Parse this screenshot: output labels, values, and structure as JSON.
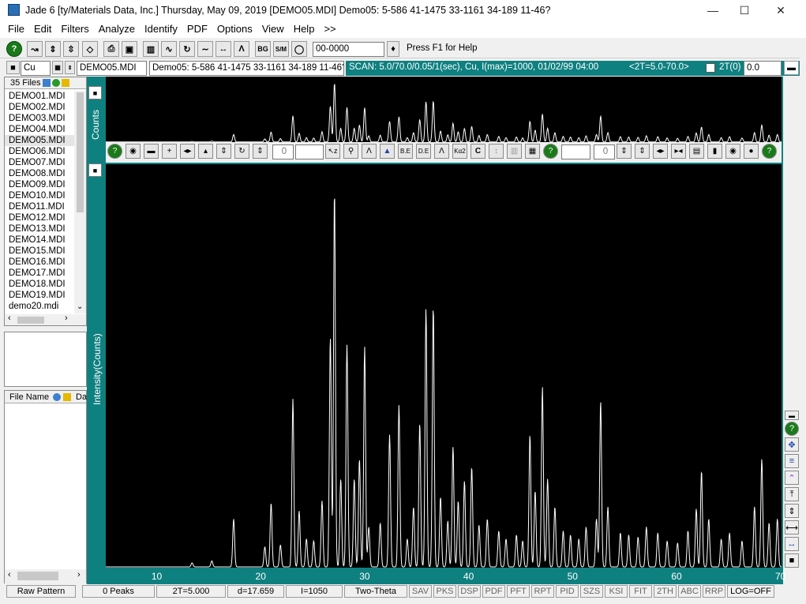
{
  "window": {
    "title": "Jade 6 [ty/Materials Data, Inc.] Thursday, May 09, 2019 [DEMO05.MDI] Demo05: 5-586 41-1475 33-1161 34-189 11-46?"
  },
  "menu": [
    "File",
    "Edit",
    "Filters",
    "Analyze",
    "Identify",
    "PDF",
    "Options",
    "View",
    "Help",
    ">>"
  ],
  "toolbar": {
    "pdf_select": "00-0000",
    "help_text": "Press F1 for Help",
    "bg_label": "BG",
    "sm_label": "S/M"
  },
  "row2": {
    "anode": "Cu",
    "file_select": "DEMO05.MDI",
    "pattern_desc": "Demo05: 5-586 41-1475 33-1161 34-189 11-46?",
    "scan_info": "SCAN: 5.0/70.0/0.05/1(sec), Cu, I(max)=1000, 01/02/99 04:00",
    "range": "<2T=5.0-70.0>",
    "two_theta_label": "2T(0)",
    "two_theta_value": "0.0"
  },
  "files": {
    "header": "35 Files",
    "items": [
      "DEMO01.MDI",
      "DEMO02.MDI",
      "DEMO03.MDI",
      "DEMO04.MDI",
      "DEMO05.MDI",
      "DEMO06.MDI",
      "DEMO07.MDI",
      "DEMO08.MDI",
      "DEMO09.MDI",
      "DEMO10.MDI",
      "DEMO11.MDI",
      "DEMO12.MDI",
      "DEMO13.MDI",
      "DEMO14.MDI",
      "DEMO15.MDI",
      "DEMO16.MDI",
      "DEMO17.MDI",
      "DEMO18.MDI",
      "DEMO19.MDI",
      "demo20.mdi"
    ],
    "selected": "DEMO05.MDI",
    "col_filename": "File Name",
    "col_da": "Da"
  },
  "plot": {
    "top_axis_label": "Counts",
    "main_axis_label": "Intensity(Counts)",
    "zoom_value": "0",
    "toolbar_value": "0"
  },
  "chart_data": {
    "type": "line",
    "xlabel": "",
    "ylabel": "Intensity(Counts)",
    "xlim": [
      5,
      70
    ],
    "ylim": [
      0,
      1000
    ],
    "xticks": [
      10,
      20,
      30,
      40,
      50,
      60,
      70
    ],
    "peaks": [
      {
        "x": 13.3,
        "y": 10
      },
      {
        "x": 15.2,
        "y": 15
      },
      {
        "x": 17.3,
        "y": 120
      },
      {
        "x": 20.3,
        "y": 50
      },
      {
        "x": 20.9,
        "y": 160
      },
      {
        "x": 21.8,
        "y": 55
      },
      {
        "x": 23.0,
        "y": 420
      },
      {
        "x": 23.6,
        "y": 140
      },
      {
        "x": 24.3,
        "y": 70
      },
      {
        "x": 25.0,
        "y": 65
      },
      {
        "x": 25.8,
        "y": 165
      },
      {
        "x": 26.6,
        "y": 575
      },
      {
        "x": 27.0,
        "y": 940
      },
      {
        "x": 27.6,
        "y": 220
      },
      {
        "x": 28.2,
        "y": 555
      },
      {
        "x": 28.9,
        "y": 220
      },
      {
        "x": 29.4,
        "y": 270
      },
      {
        "x": 29.9,
        "y": 550
      },
      {
        "x": 30.3,
        "y": 100
      },
      {
        "x": 31.4,
        "y": 110
      },
      {
        "x": 32.3,
        "y": 330
      },
      {
        "x": 33.2,
        "y": 405
      },
      {
        "x": 34.0,
        "y": 70
      },
      {
        "x": 34.6,
        "y": 150
      },
      {
        "x": 35.2,
        "y": 360
      },
      {
        "x": 35.8,
        "y": 645
      },
      {
        "x": 36.5,
        "y": 650
      },
      {
        "x": 37.2,
        "y": 175
      },
      {
        "x": 37.9,
        "y": 115
      },
      {
        "x": 38.4,
        "y": 300
      },
      {
        "x": 38.9,
        "y": 165
      },
      {
        "x": 39.5,
        "y": 215
      },
      {
        "x": 40.2,
        "y": 250
      },
      {
        "x": 40.9,
        "y": 105
      },
      {
        "x": 41.7,
        "y": 120
      },
      {
        "x": 42.8,
        "y": 90
      },
      {
        "x": 43.5,
        "y": 70
      },
      {
        "x": 44.5,
        "y": 80
      },
      {
        "x": 45.1,
        "y": 65
      },
      {
        "x": 45.8,
        "y": 330
      },
      {
        "x": 46.3,
        "y": 190
      },
      {
        "x": 47.0,
        "y": 450
      },
      {
        "x": 47.5,
        "y": 220
      },
      {
        "x": 48.2,
        "y": 150
      },
      {
        "x": 49.0,
        "y": 90
      },
      {
        "x": 49.7,
        "y": 80
      },
      {
        "x": 50.5,
        "y": 70
      },
      {
        "x": 51.2,
        "y": 100
      },
      {
        "x": 52.2,
        "y": 120
      },
      {
        "x": 52.6,
        "y": 415
      },
      {
        "x": 53.3,
        "y": 150
      },
      {
        "x": 54.5,
        "y": 85
      },
      {
        "x": 55.3,
        "y": 80
      },
      {
        "x": 56.2,
        "y": 75
      },
      {
        "x": 57.0,
        "y": 100
      },
      {
        "x": 58.1,
        "y": 85
      },
      {
        "x": 59.0,
        "y": 65
      },
      {
        "x": 60.0,
        "y": 60
      },
      {
        "x": 61.0,
        "y": 90
      },
      {
        "x": 61.8,
        "y": 145
      },
      {
        "x": 62.3,
        "y": 240
      },
      {
        "x": 63.0,
        "y": 120
      },
      {
        "x": 64.2,
        "y": 70
      },
      {
        "x": 65.0,
        "y": 85
      },
      {
        "x": 66.2,
        "y": 65
      },
      {
        "x": 67.4,
        "y": 150
      },
      {
        "x": 68.1,
        "y": 270
      },
      {
        "x": 68.8,
        "y": 110
      },
      {
        "x": 69.6,
        "y": 120
      }
    ]
  },
  "status": {
    "mode": "Raw Pattern",
    "peaks": "0 Peaks",
    "two_theta": "2T=5.000",
    "d": "d=17.659",
    "intensity": "I=1050",
    "axis": "Two-Theta",
    "tabs": [
      "SAV",
      "PKS",
      "DSP",
      "PDF",
      "PFT",
      "RPT",
      "PID",
      "SZS",
      "KSI",
      "FIT",
      "2TH",
      "ABC",
      "RRP"
    ],
    "log": "LOG=OFF"
  },
  "colors": {
    "frame": "#0f8080",
    "plot_bg": "#000000",
    "trace": "#ffffff"
  }
}
